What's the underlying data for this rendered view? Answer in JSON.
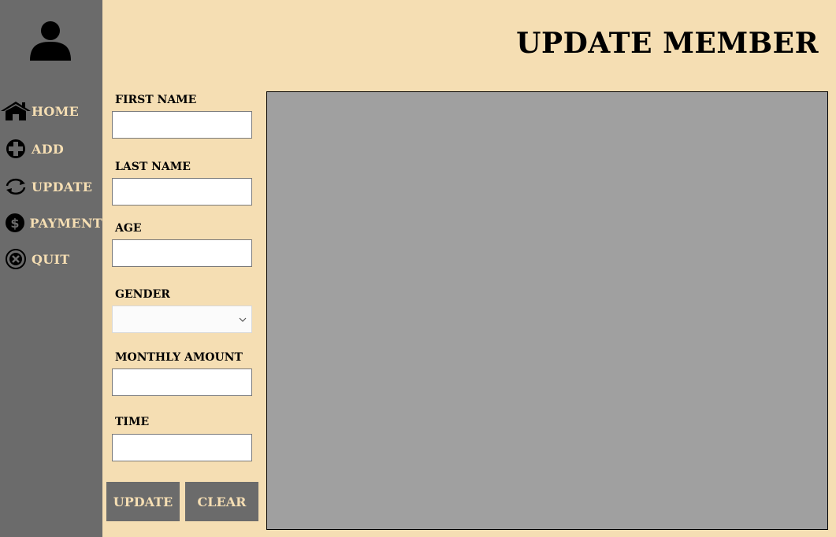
{
  "page": {
    "title": "UPDATE MEMBER"
  },
  "sidebar": {
    "avatar_icon": "user-icon",
    "items": [
      {
        "label": "HOME",
        "icon": "home-icon"
      },
      {
        "label": "ADD",
        "icon": "plus-circle-icon"
      },
      {
        "label": "UPDATE",
        "icon": "refresh-icon"
      },
      {
        "label": "PAYMENT",
        "icon": "dollar-circle-icon"
      },
      {
        "label": "QUIT",
        "icon": "close-circle-icon"
      }
    ]
  },
  "form": {
    "first_name": {
      "label": "FIRST NAME",
      "value": ""
    },
    "last_name": {
      "label": "LAST NAME",
      "value": ""
    },
    "age": {
      "label": "AGE",
      "value": ""
    },
    "gender": {
      "label": "GENDER",
      "value": ""
    },
    "monthly_amount": {
      "label": "MONTHLY AMOUNT",
      "value": ""
    },
    "time": {
      "label": "TIME",
      "value": ""
    }
  },
  "buttons": {
    "update_label": "UPDATE",
    "clear_label": "CLEAR"
  },
  "colors": {
    "sidebar": "#6b6b6b",
    "background": "#f5deb3",
    "accent_text": "#f5deb3",
    "grid": "#a0a0a0"
  }
}
